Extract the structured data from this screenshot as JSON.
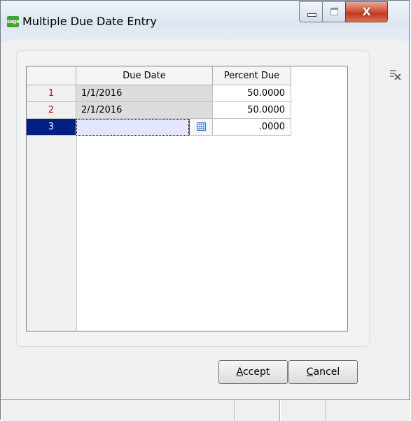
{
  "window": {
    "app_icon_text": "sage",
    "title": "Multiple Due Date Entry",
    "close_symbol": "X"
  },
  "grid": {
    "columns": [
      "Due Date",
      "Percent Due"
    ],
    "rows": [
      {
        "num": "1",
        "due_date": "1/1/2016",
        "percent_due": "50.0000"
      },
      {
        "num": "2",
        "due_date": "2/1/2016",
        "percent_due": "50.0000"
      },
      {
        "num": "3",
        "due_date": "",
        "percent_due": ".0000"
      }
    ]
  },
  "buttons": {
    "accept": {
      "mnemonic": "A",
      "rest": "ccept"
    },
    "cancel": {
      "mnemonic": "C",
      "rest": "ancel"
    }
  },
  "icons": {
    "clear_grid": "clear-grid-icon",
    "calendar": "calendar-icon"
  },
  "colors": {
    "active_row": "#001e84",
    "row_number": "#d00000",
    "edit_cell": "#e4e6ff",
    "close_button": "#c03b20"
  }
}
